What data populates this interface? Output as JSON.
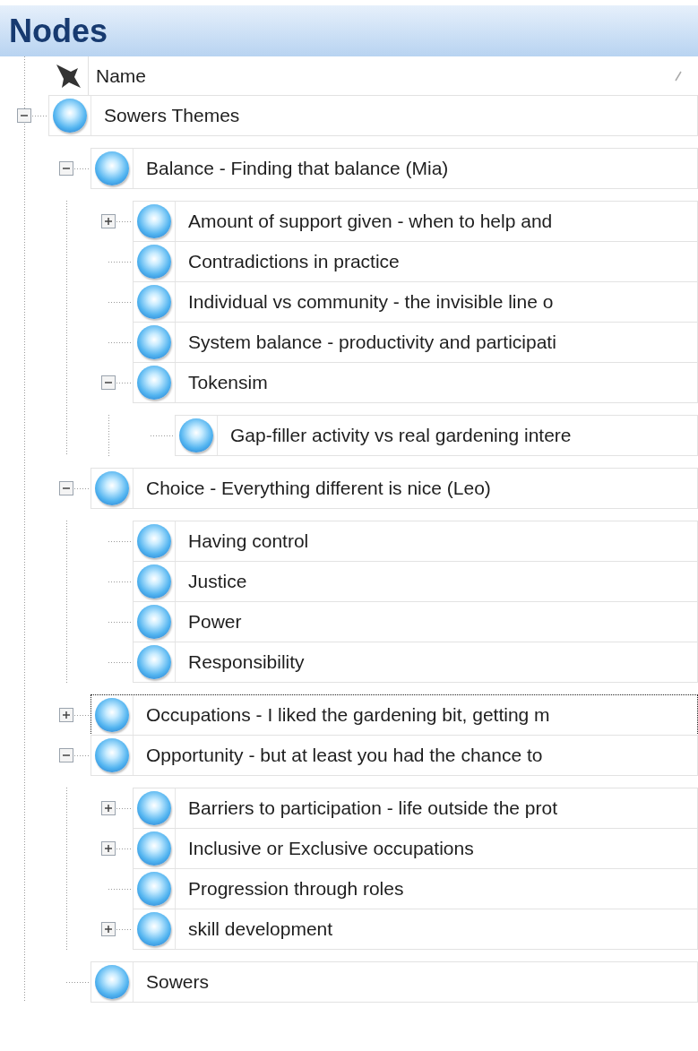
{
  "panel": {
    "title": "Nodes"
  },
  "header": {
    "column": "Name"
  },
  "tree": [
    {
      "label": "Sowers Themes",
      "expanded": true,
      "focused": false,
      "children": [
        {
          "label": "Balance - Finding that balance (Mia)",
          "expanded": true,
          "focused": false,
          "children": [
            {
              "label": "Amount of support given - when to help and",
              "expanded": false,
              "focused": false
            },
            {
              "label": "Contradictions in practice",
              "focused": false
            },
            {
              "label": "Individual vs community -  the invisible line o",
              "focused": false
            },
            {
              "label": "System balance - productivity and participati",
              "focused": false
            },
            {
              "label": "Tokensim",
              "expanded": true,
              "focused": false,
              "children": [
                {
                  "label": "Gap-filler activity vs real gardening intere",
                  "focused": false
                }
              ]
            }
          ]
        },
        {
          "label": "Choice - Everything different is nice (Leo)",
          "expanded": true,
          "focused": false,
          "children": [
            {
              "label": "Having control",
              "focused": false
            },
            {
              "label": "Justice",
              "focused": false
            },
            {
              "label": "Power",
              "focused": false
            },
            {
              "label": "Responsibility",
              "focused": false
            }
          ]
        },
        {
          "label": "Occupations - I liked the gardening bit, getting m",
          "expanded": false,
          "focused": true
        },
        {
          "label": "Opportunity - but at least you had the chance to",
          "expanded": true,
          "focused": false,
          "children": [
            {
              "label": "Barriers to participation - life outside the prot",
              "expanded": false,
              "focused": false
            },
            {
              "label": "Inclusive or Exclusive occupations",
              "expanded": false,
              "focused": false
            },
            {
              "label": "Progression through roles",
              "focused": false
            },
            {
              "label": "skill development",
              "expanded": false,
              "focused": false
            }
          ]
        },
        {
          "label": "Sowers",
          "focused": false
        }
      ]
    }
  ]
}
